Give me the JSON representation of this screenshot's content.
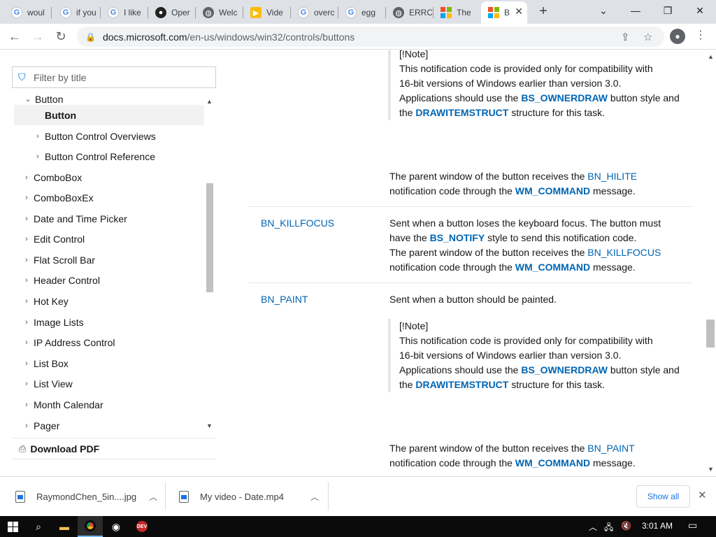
{
  "browser": {
    "tabs": [
      {
        "title": "woul",
        "icon": "google-icon"
      },
      {
        "title": "if you",
        "icon": "google-icon"
      },
      {
        "title": "I like",
        "icon": "google-icon"
      },
      {
        "title": "Oper",
        "icon": "obs-icon"
      },
      {
        "title": "Welc",
        "icon": "globe-icon"
      },
      {
        "title": "Vide",
        "icon": "video-icon"
      },
      {
        "title": "overc",
        "icon": "google-icon"
      },
      {
        "title": "egg",
        "icon": "google-icon"
      },
      {
        "title": "ERRC",
        "icon": "globe-icon"
      },
      {
        "title": "The",
        "icon": "microsoft-icon"
      },
      {
        "title": "B",
        "icon": "microsoft-icon",
        "active": true
      }
    ],
    "address": {
      "host": "docs.microsoft.com",
      "path": "/en-us/windows/win32/controls/buttons"
    }
  },
  "sidebar": {
    "filter_placeholder": "Filter by title",
    "items": [
      {
        "label": "Button",
        "chevron": "open",
        "level": 1
      },
      {
        "label": "Button",
        "chevron": "",
        "level": 2,
        "selected": true
      },
      {
        "label": "Button Control Overviews",
        "chevron": "right",
        "level": 2
      },
      {
        "label": "Button Control Reference",
        "chevron": "right",
        "level": 2
      },
      {
        "label": "ComboBox",
        "chevron": "right",
        "level": 1
      },
      {
        "label": "ComboBoxEx",
        "chevron": "right",
        "level": 1
      },
      {
        "label": "Date and Time Picker",
        "chevron": "right",
        "level": 1
      },
      {
        "label": "Edit Control",
        "chevron": "right",
        "level": 1
      },
      {
        "label": "Flat Scroll Bar",
        "chevron": "right",
        "level": 1
      },
      {
        "label": "Header Control",
        "chevron": "right",
        "level": 1
      },
      {
        "label": "Hot Key",
        "chevron": "right",
        "level": 1
      },
      {
        "label": "Image Lists",
        "chevron": "right",
        "level": 1
      },
      {
        "label": "IP Address Control",
        "chevron": "right",
        "level": 1
      },
      {
        "label": "List Box",
        "chevron": "right",
        "level": 1
      },
      {
        "label": "List View",
        "chevron": "right",
        "level": 1
      },
      {
        "label": "Month Calendar",
        "chevron": "right",
        "level": 1
      },
      {
        "label": "Pager",
        "chevron": "right",
        "level": 1
      }
    ],
    "download_pdf": "Download PDF"
  },
  "content": {
    "note1": {
      "tag": "[!Note]",
      "line1": "This notification code is provided only for compatibility with",
      "line2": "16-bit versions of Windows earlier than version 3.0.",
      "line3_pre": "Applications should use the ",
      "line3_code": "BS_OWNERDRAW",
      "line3_post": " button style and",
      "line4_pre": "the ",
      "line4_code": "DRAWITEMSTRUCT",
      "line4_post": " structure for this task."
    },
    "hilite": {
      "pre": "The parent window of the button receives the ",
      "code": "BN_HILITE",
      "l2_pre": "notification code through the ",
      "l2_code": "WM_COMMAND",
      "l2_post": " message."
    },
    "killfocus": {
      "term": "BN_KILLFOCUS",
      "l1": "Sent when a button loses the keyboard focus. The button must",
      "l2_pre": "have the ",
      "l2_code": "BS_NOTIFY",
      "l2_post": " style to send this notification code.",
      "l3_pre": "The parent window of the button receives the ",
      "l3_code": "BN_KILLFOCUS",
      "l4_pre": "notification code through the ",
      "l4_code": "WM_COMMAND",
      "l4_post": " message."
    },
    "paint": {
      "term": "BN_PAINT",
      "l1": "Sent when a button should be painted.",
      "note": {
        "tag": "[!Note]",
        "line1": "This notification code is provided only for compatibility with",
        "line2": "16-bit versions of Windows earlier than version 3.0.",
        "line3_pre": "Applications should use the ",
        "line3_code": "BS_OWNERDRAW",
        "line3_post": " button style and",
        "line4_pre": "the ",
        "line4_code": "DRAWITEMSTRUCT",
        "line4_post": " structure for this task."
      },
      "p_pre": "The parent window of the button receives the ",
      "p_code": "BN_PAINT",
      "p2_pre": "notification code through the ",
      "p2_code": "WM_COMMAND",
      "p2_post": " message."
    }
  },
  "downloads": {
    "items": [
      {
        "name": "RaymondChen_5in....jpg"
      },
      {
        "name": "My video - Date.mp4"
      }
    ],
    "show_all": "Show all"
  },
  "taskbar": {
    "time": "3:01 AM"
  }
}
